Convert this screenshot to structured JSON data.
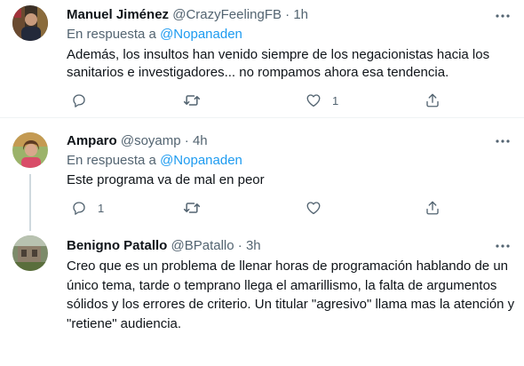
{
  "tweets": [
    {
      "name": "Manuel Jiménez",
      "handle": "@CrazyFeelingFB",
      "sep": "·",
      "time": "1h",
      "reply_prefix": "En respuesta a",
      "reply_to": "@Nopanaden",
      "text": "Además, los insultos han venido siempre de los negacionistas hacia los sanitarios e investigadores... no rompamos ahora esa tendencia.",
      "reply_count": "",
      "retweet_count": "",
      "like_count": "1"
    },
    {
      "name": "Amparo",
      "handle": "@soyamp",
      "sep": "·",
      "time": "4h",
      "reply_prefix": "En respuesta a",
      "reply_to": "@Nopanaden",
      "text": "Este programa va de mal en peor",
      "reply_count": "1",
      "retweet_count": "",
      "like_count": ""
    },
    {
      "name": "Benigno Patallo",
      "handle": "@BPatallo",
      "sep": "·",
      "time": "3h",
      "text": "Creo que es un problema de llenar horas de programación hablando de un único tema, tarde o temprano llega el amarillismo, la falta de argumentos sólidos y los errores de criterio. Un titular \"agresivo\" llama mas la atención y \"retiene\" audiencia."
    }
  ],
  "icons": {
    "more": "more-icon",
    "reply": "reply-icon",
    "retweet": "retweet-icon",
    "like": "like-icon",
    "share": "share-icon"
  },
  "colors": {
    "accent": "#1d9bf0",
    "muted": "#536471",
    "text": "#0f1419",
    "divider": "#eff3f4"
  }
}
